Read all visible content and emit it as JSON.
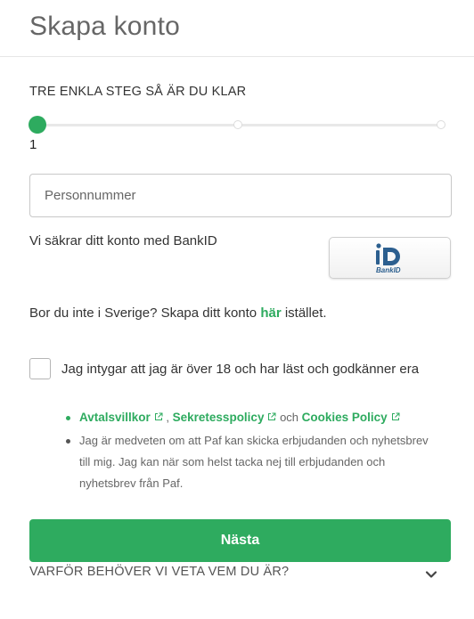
{
  "header": {
    "title": "Skapa konto"
  },
  "steps": {
    "title": "TRE ENKLA STEG SÅ ÄR DU KLAR",
    "current": "1",
    "total": 3
  },
  "form": {
    "personnummer_placeholder": "Personnummer",
    "personnummer_value": ""
  },
  "bankid": {
    "text": "Vi säkrar ditt konto med BankID",
    "logo_label": "BankID"
  },
  "abroad": {
    "prefix": "Bor du inte i Sverige? Skapa ditt konto ",
    "link": "här",
    "suffix": " istället."
  },
  "consent": {
    "checked": false,
    "text": "Jag intygar att jag är över 18 och har läst och godkänner era",
    "links": {
      "terms": "Avtalsvillkor",
      "sep1": " , ",
      "privacy": "Sekretesspolicy",
      "and": " och ",
      "cookies": "Cookies Policy"
    },
    "marketing": "Jag är medveten om att Paf kan skicka erbjudanden och nyhetsbrev till mig. Jag kan när som helst tacka nej till erbjudanden och nyhetsbrev från Paf."
  },
  "next_button": "Nästa",
  "why": {
    "label": "VARFÖR BEHÖVER VI VETA VEM DU ÄR?"
  },
  "colors": {
    "accent": "#2eab5f",
    "text": "#333333",
    "muted": "#666666",
    "border": "#c8c8c8"
  },
  "icons": [
    "bankid-logo-icon",
    "external-link-icon",
    "chevron-down-icon"
  ]
}
